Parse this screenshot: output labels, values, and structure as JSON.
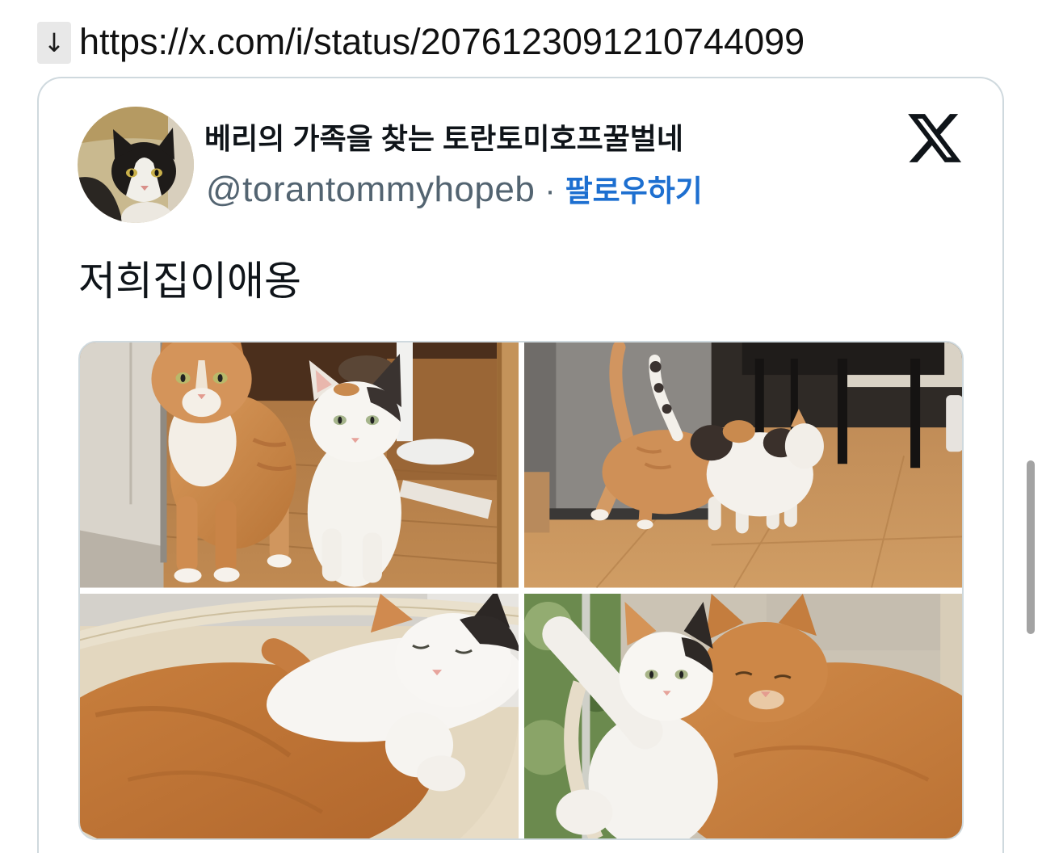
{
  "url_bar": {
    "arrow_icon": "down-arrow-icon",
    "arrow_glyph": "↓",
    "url": "https://x.com/i/status/2076123091210744099"
  },
  "tweet": {
    "author": {
      "display_name": "베리의 가족을 찾는 토란토미호프꿀벌네",
      "handle": "@torantommyhopeb",
      "avatar_icon": "avatar-cat-photo"
    },
    "separator": "·",
    "follow_label": "팔로우하기",
    "platform_icon": "x-logo-icon",
    "text": "저희집이애옹"
  },
  "colors": {
    "text_primary": "#0f1419",
    "text_secondary": "#536471",
    "accent_link": "#1d6fd0",
    "card_border": "#cfd9de",
    "url_text": "#111111",
    "scrollbar": "#a3a3a3",
    "chip_bg": "#e8e8e8"
  }
}
